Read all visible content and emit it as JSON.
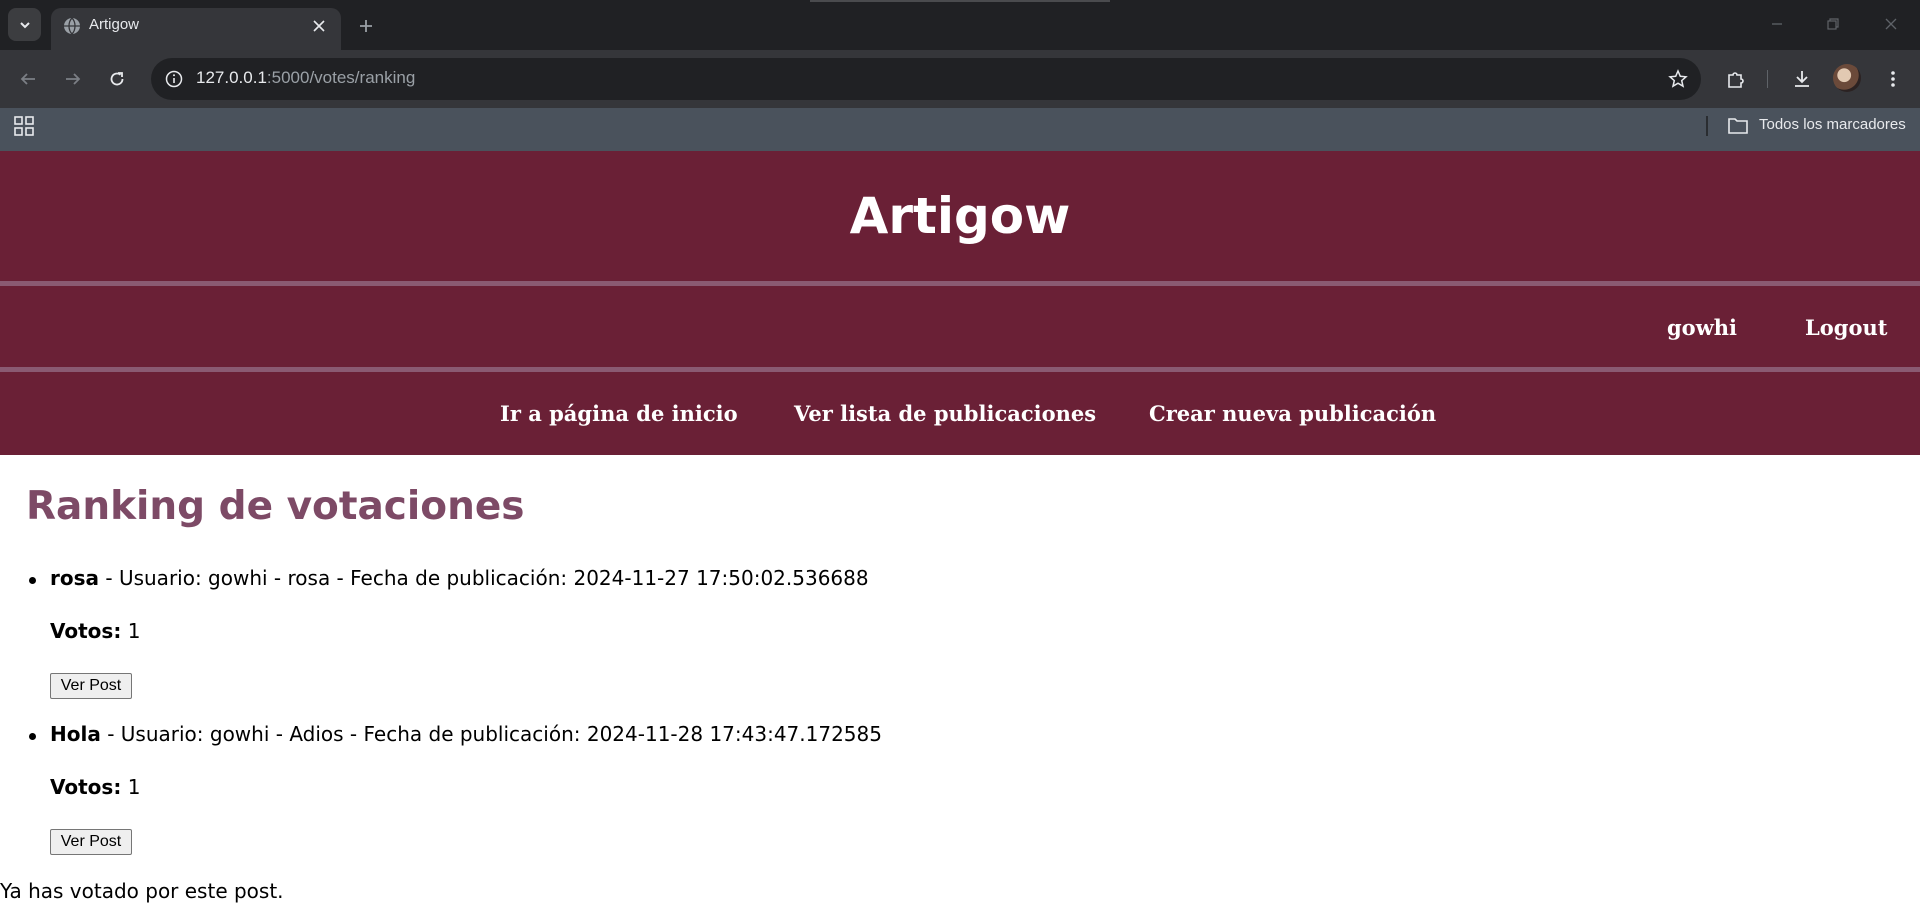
{
  "browser": {
    "tab_title": "Artigow",
    "url_host": "127.0.0.1",
    "url_path": ":5000/votes/ranking",
    "bookmarks_label": "Todos los marcadores"
  },
  "site": {
    "title": "Artigow",
    "username": "gowhi",
    "logout_label": "Logout",
    "nav": {
      "home": "Ir a página de inicio",
      "posts": "Ver lista de publicaciones",
      "create": "Crear nueva publicación"
    }
  },
  "ranking": {
    "heading": "Ranking de votaciones",
    "items": [
      {
        "title": "rosa",
        "details": " - Usuario: gowhi - rosa - Fecha de publicación: 2024-11-27 17:50:02.536688",
        "votes_label": "Votos:",
        "votes": "1",
        "button": "Ver Post"
      },
      {
        "title": "Hola",
        "details": " - Usuario: gowhi - Adios - Fecha de publicación: 2024-11-28 17:43:47.172585",
        "votes_label": "Votos:",
        "votes": "1",
        "button": "Ver Post"
      }
    ],
    "message": "Ya has votado por este post."
  },
  "colors": {
    "header_bg": "#6a2036",
    "heading": "#7d4a66"
  }
}
